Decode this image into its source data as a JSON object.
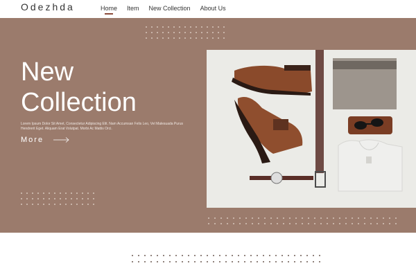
{
  "header": {
    "logo": "Odezhda",
    "nav": [
      {
        "label": "Home",
        "active": true
      },
      {
        "label": "Item",
        "active": false
      },
      {
        "label": "New Collection",
        "active": false
      },
      {
        "label": "About Us",
        "active": false
      }
    ]
  },
  "hero": {
    "title_line1": "New",
    "title_line2": "Collection",
    "description": "Lorem Ipsum Dolor Sit Amet, Consectetur Adipiscing Elit. Nam Accumsan Felis Leo, Vel Malesuada Purus Hendrerit Eget. Aliquam Erat Volutpat. Morbi Ac Mattis Orci.",
    "more_label": "More"
  },
  "colors": {
    "hero_bg": "#9b7b6c",
    "accent": "#8b4a3a",
    "text": "#2b2b2b"
  },
  "icons": {
    "arrow": "arrow-right-icon"
  }
}
